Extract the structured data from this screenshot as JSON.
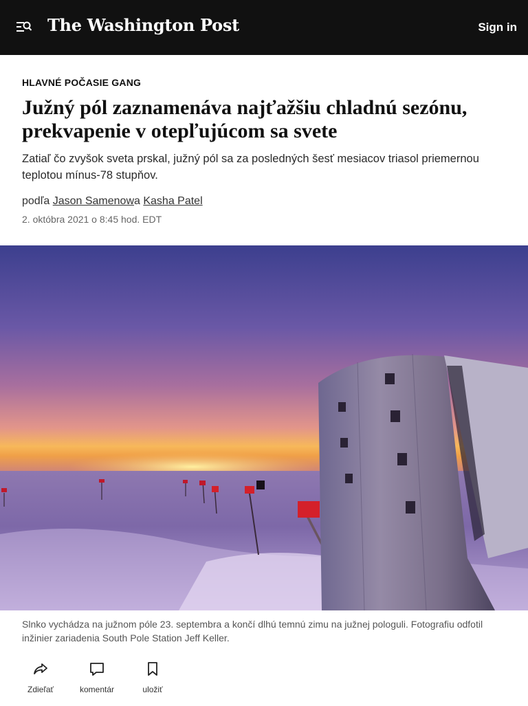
{
  "header": {
    "logo": "The Washington Post",
    "sign_in": "Sign in",
    "menu_icon": "menu-search-icon"
  },
  "article": {
    "kicker": "HLAVNÉ POČASIE GANG",
    "headline": "Južný pól zaznamenáva najťažšiu chladnú sezónu, prekvapenie v otepľujúcom sa svete",
    "dek": "Zatiaľ čo zvyšok sveta prskal, južný pól sa za posledných šesť mesiacov triasol priemernou teplotou mínus-78 stupňov.",
    "byline": {
      "prefix": "podľa ",
      "author1": "Jason Samenow",
      "joiner": "a ",
      "author2": "Kasha Patel"
    },
    "date": "2. októbra 2021 o 8:45 hod. EDT"
  },
  "photo": {
    "caption": "Slnko vychádza na južnom póle 23. septembra a končí dlhú temnú zimu na južnej pologuli. Fotografiu odfotil inžinier zariadenia South Pole Station Jeff Keller."
  },
  "toolbar": {
    "share": "Zdieľať",
    "comment": "komentár",
    "save": "uložiť"
  }
}
